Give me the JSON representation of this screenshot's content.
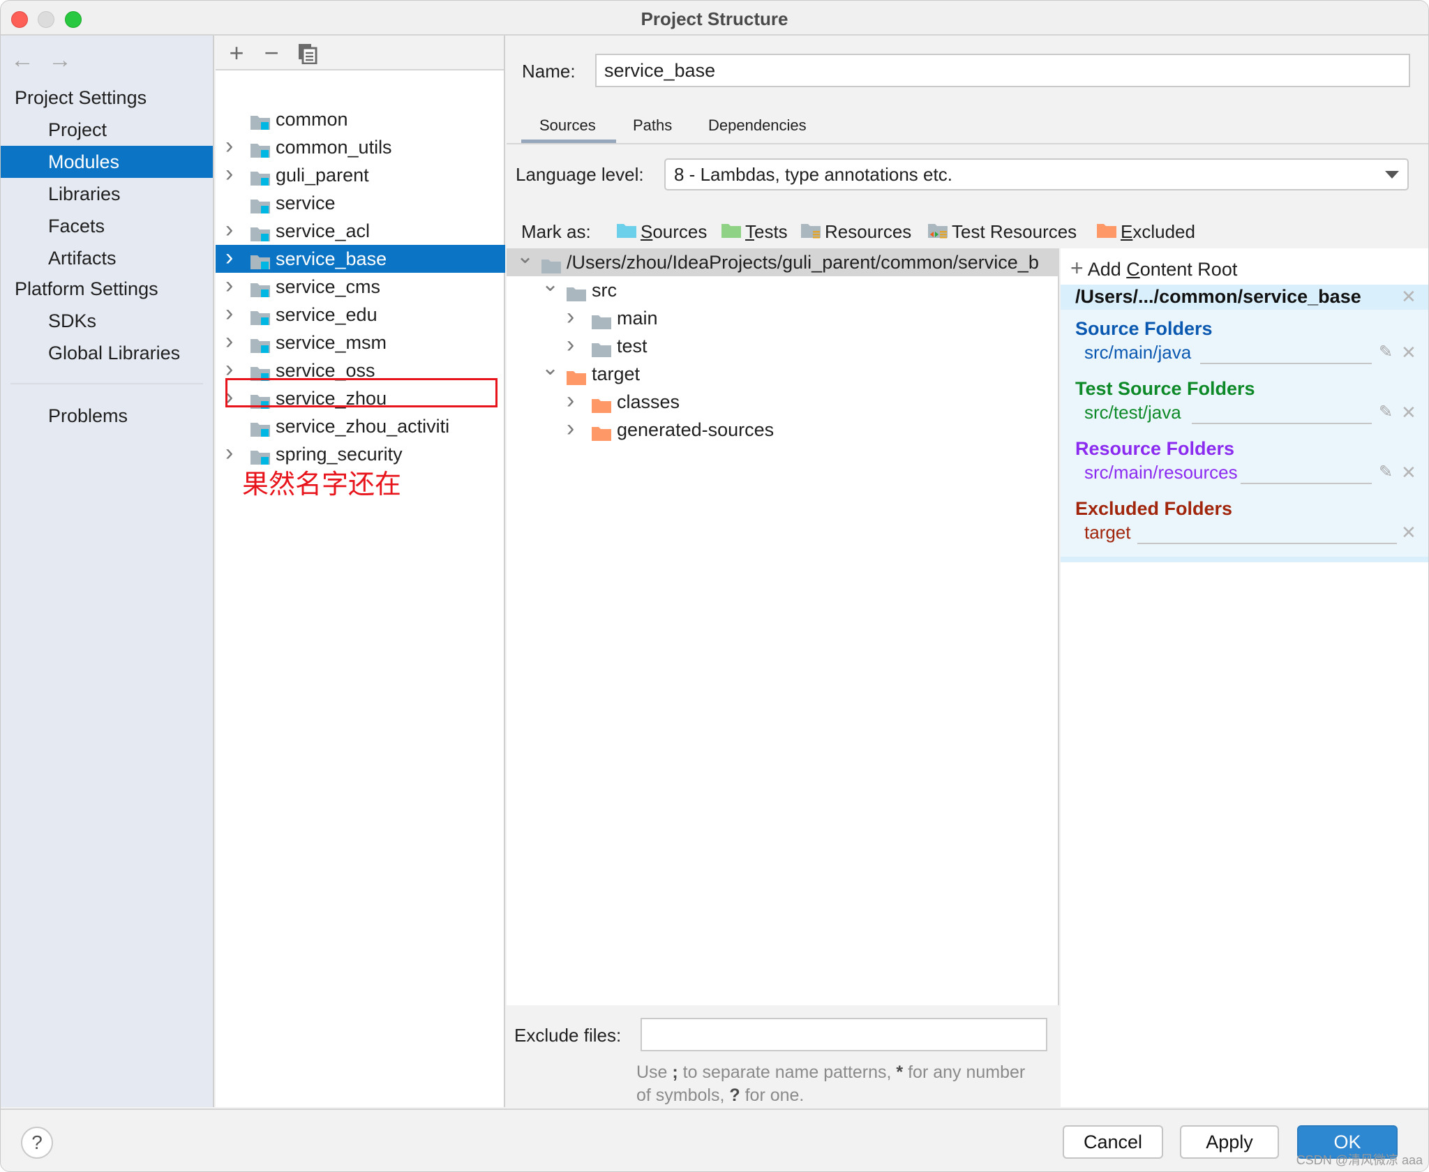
{
  "window": {
    "title": "Project Structure"
  },
  "nav": {
    "back_icon": "arrow-left-icon",
    "forward_icon": "arrow-right-icon",
    "project_settings_header": "Project Settings",
    "project_settings_items": [
      {
        "label": "Project",
        "selected": false
      },
      {
        "label": "Modules",
        "selected": true
      },
      {
        "label": "Libraries",
        "selected": false
      },
      {
        "label": "Facets",
        "selected": false
      },
      {
        "label": "Artifacts",
        "selected": false
      }
    ],
    "platform_settings_header": "Platform Settings",
    "platform_settings_items": [
      {
        "label": "SDKs"
      },
      {
        "label": "Global Libraries"
      }
    ],
    "problems_label": "Problems"
  },
  "modules_toolbar": {
    "add_icon": "plus-icon",
    "remove_icon": "minus-icon",
    "copy_icon": "copy-icon"
  },
  "modules": [
    {
      "name": "common",
      "expandable": false,
      "selected": false
    },
    {
      "name": "common_utils",
      "expandable": true,
      "selected": false
    },
    {
      "name": "guli_parent",
      "expandable": true,
      "selected": false
    },
    {
      "name": "service",
      "expandable": false,
      "selected": false
    },
    {
      "name": "service_acl",
      "expandable": true,
      "selected": false
    },
    {
      "name": "service_base",
      "expandable": true,
      "selected": true
    },
    {
      "name": "service_cms",
      "expandable": true,
      "selected": false
    },
    {
      "name": "service_edu",
      "expandable": true,
      "selected": false
    },
    {
      "name": "service_msm",
      "expandable": true,
      "selected": false
    },
    {
      "name": "service_oss",
      "expandable": true,
      "selected": false
    },
    {
      "name": "service_zhou",
      "expandable": true,
      "selected": false
    },
    {
      "name": "service_zhou_activiti",
      "expandable": false,
      "selected": false,
      "highlighted": true
    },
    {
      "name": "spring_security",
      "expandable": true,
      "selected": false
    }
  ],
  "annotation": {
    "text": "果然名字还在",
    "color": "#e8141b"
  },
  "detail": {
    "name_label": "Name:",
    "name_value": "service_base",
    "tabs": [
      {
        "label": "Sources",
        "active": true
      },
      {
        "label": "Paths",
        "active": false
      },
      {
        "label": "Dependencies",
        "active": false
      }
    ],
    "language_level_label": "Language level:",
    "language_level_value": "8 - Lambdas, type annotations etc.",
    "mark_as_label": "Mark as:",
    "mark_as": [
      {
        "label": "Sources",
        "mnemonic": "S",
        "rest": "ources",
        "icon": "sources-folder-icon",
        "color": "#6cd0ea"
      },
      {
        "label": "Tests",
        "mnemonic": "T",
        "rest": "ests",
        "icon": "tests-folder-icon",
        "color": "#8fd185"
      },
      {
        "label": "Resources",
        "mnemonic": "",
        "rest": "Resources",
        "icon": "resources-folder-icon",
        "color": "#aab7bf"
      },
      {
        "label": "Test Resources",
        "mnemonic": "",
        "rest": "Test Resources",
        "icon": "test-resources-folder-icon",
        "color": "#aab7bf"
      },
      {
        "label": "Excluded",
        "mnemonic": "E",
        "rest": "xcluded",
        "icon": "excluded-folder-icon",
        "color": "#ff9867"
      }
    ],
    "tree": [
      {
        "label": "/Users/zhou/IdeaProjects/guli_parent/common/service_b",
        "level": 0,
        "state": "expanded",
        "type": "plain",
        "root": true
      },
      {
        "label": "src",
        "level": 1,
        "state": "expanded",
        "type": "plain"
      },
      {
        "label": "main",
        "level": 2,
        "state": "collapsed",
        "type": "plain"
      },
      {
        "label": "test",
        "level": 2,
        "state": "collapsed",
        "type": "plain"
      },
      {
        "label": "target",
        "level": 1,
        "state": "expanded",
        "type": "excluded"
      },
      {
        "label": "classes",
        "level": 2,
        "state": "collapsed",
        "type": "excluded"
      },
      {
        "label": "generated-sources",
        "level": 2,
        "state": "collapsed",
        "type": "excluded"
      }
    ],
    "exclude_files_label": "Exclude files:",
    "exclude_files_value": "",
    "exclude_hint_parts": [
      "Use ",
      ";",
      " to separate name patterns, ",
      "*",
      " for any number of symbols, ",
      "?",
      " for one."
    ]
  },
  "content_root": {
    "add_label_pre": "Add ",
    "add_label_mnemonic": "C",
    "add_label_post": "ontent Root",
    "path": "/Users/.../common/service_base",
    "groups": [
      {
        "title": "Source Folders",
        "path": "src/main/java",
        "color": "#0a58b0",
        "editable": true
      },
      {
        "title": "Test Source Folders",
        "path": "src/test/java",
        "color": "#0d8a27",
        "editable": true
      },
      {
        "title": "Resource Folders",
        "path": "src/main/resources",
        "color": "#8c2bf0",
        "editable": true
      },
      {
        "title": "Excluded Folders",
        "path": "target",
        "color": "#a0250b",
        "editable": false
      }
    ]
  },
  "footer": {
    "help_label": "?",
    "cancel_label": "Cancel",
    "apply_label": "Apply",
    "ok_label": "OK",
    "watermark": "CSDN @清风微凉 aaa"
  }
}
